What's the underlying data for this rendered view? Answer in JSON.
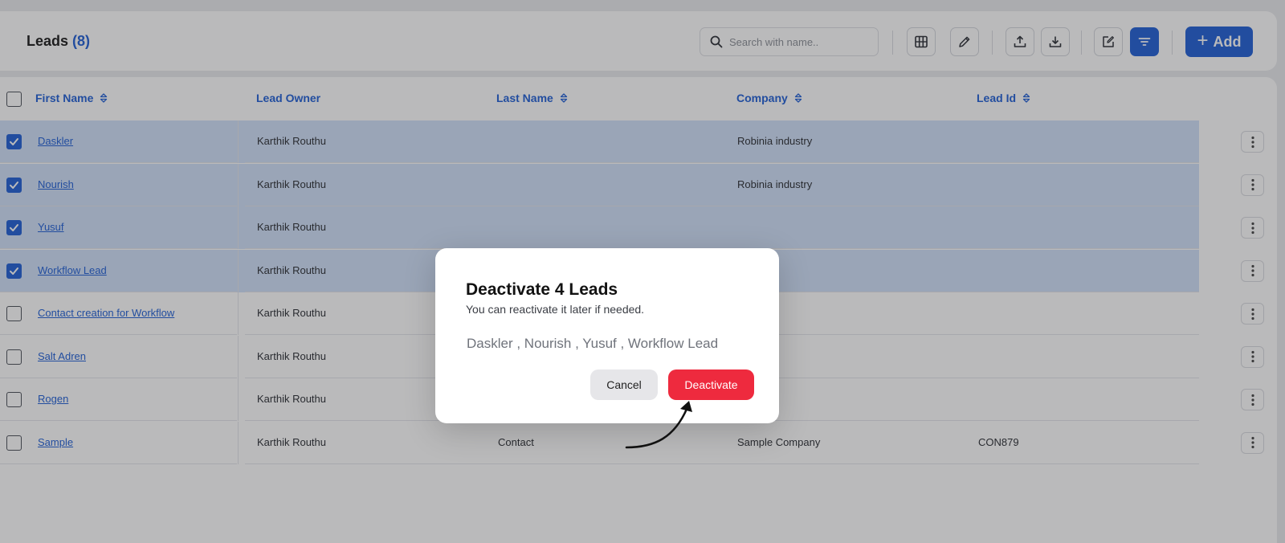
{
  "header": {
    "title": "Leads",
    "count": "(8)",
    "search_placeholder": "Search with name..",
    "add_label": "Add",
    "toolbar_icons": [
      "columns-icon",
      "edit-icon",
      "upload-icon",
      "download-icon",
      "bulk-edit-icon",
      "filter-icon"
    ]
  },
  "table": {
    "columns": [
      "First Name",
      "Lead Owner",
      "Last Name",
      "Company",
      "Lead Id"
    ],
    "rows": [
      {
        "first_name": "Daskler",
        "lead_owner": "Karthik Routhu",
        "last_name": "",
        "company": "Robinia industry",
        "lead_id": "",
        "checked": true
      },
      {
        "first_name": "Nourish",
        "lead_owner": "Karthik Routhu",
        "last_name": "",
        "company": "Robinia industry",
        "lead_id": "",
        "checked": true
      },
      {
        "first_name": "Yusuf",
        "lead_owner": "Karthik Routhu",
        "last_name": "",
        "company": "",
        "lead_id": "",
        "checked": true
      },
      {
        "first_name": "Workflow Lead",
        "lead_owner": "Karthik Routhu",
        "last_name": "",
        "company": "",
        "lead_id": "",
        "checked": true
      },
      {
        "first_name": "Contact creation for Workflow",
        "lead_owner": "Karthik Routhu",
        "last_name": "",
        "company": "",
        "lead_id": "",
        "checked": false
      },
      {
        "first_name": "Salt Adren",
        "lead_owner": "Karthik Routhu",
        "last_name": "",
        "company": "",
        "lead_id": "",
        "checked": false
      },
      {
        "first_name": "Rogen",
        "lead_owner": "Karthik Routhu",
        "last_name": "",
        "company": "",
        "lead_id": "",
        "checked": false
      },
      {
        "first_name": "Sample",
        "lead_owner": "Karthik Routhu",
        "last_name": "Contact",
        "company": "Sample Company",
        "lead_id": "CON879",
        "checked": false
      }
    ]
  },
  "modal": {
    "title": "Deactivate 4 Leads",
    "subtitle": "You can reactivate it later if needed.",
    "names": "Daskler , Nourish , Yusuf , Workflow Lead",
    "cancel_label": "Cancel",
    "confirm_label": "Deactivate"
  },
  "colors": {
    "accent": "#1f5fd6",
    "danger": "#ee2a3e",
    "selected_row": "#d0e0f9"
  }
}
